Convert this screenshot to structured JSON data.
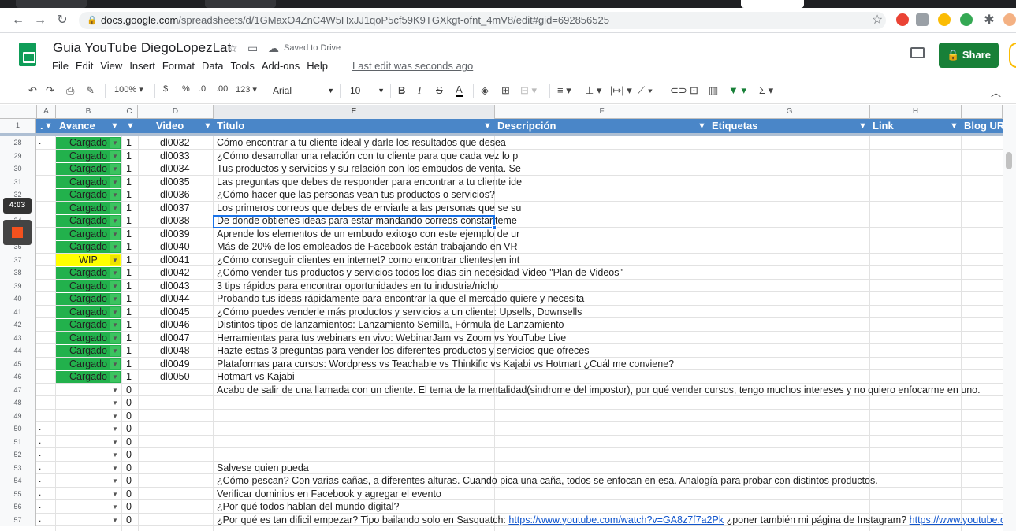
{
  "browser": {
    "url_host": "docs.google.com",
    "url_path": "/spreadsheets/d/1GMaxO4ZnC4W5HxJJ1qoP5cf59K9TGXkgt-ofnt_4mV8/edit#gid=692856525"
  },
  "doc": {
    "title": "Guia YouTube DiegoLopezLat",
    "saved_status": "Saved to Drive",
    "last_edit": "Last edit was seconds ago",
    "share_label": "Share",
    "menu": [
      "File",
      "Edit",
      "View",
      "Insert",
      "Format",
      "Data",
      "Tools",
      "Add-ons",
      "Help"
    ]
  },
  "toolbar": {
    "zoom": "100%",
    "currency": "$",
    "percent": "%",
    "dec_less": ".0",
    "dec_more": ".00",
    "format": "123",
    "font": "Arial",
    "font_size": "10",
    "bold": "B",
    "italic": "I",
    "strike": "S",
    "textcolor": "A",
    "sigma": "Σ"
  },
  "columns": [
    "A",
    "B",
    "C",
    "D",
    "E",
    "F",
    "G",
    "H"
  ],
  "header_row": {
    "num": "1",
    "a": ".",
    "b": "Avance",
    "d": "Video",
    "e": "Titulo",
    "f": "Descripción",
    "g": "Etiquetas",
    "h": "Link",
    "i": "Blog UR"
  },
  "rows": [
    {
      "num": "28",
      "a": ".",
      "status": "Cargado",
      "c": "1",
      "d": "dl0032",
      "e": "Cómo encontrar a tu cliente ideal y darle los resultados que desea"
    },
    {
      "num": "29",
      "a": "",
      "status": "Cargado",
      "c": "1",
      "d": "dl0033",
      "e": "¿Cómo desarrollar una relación con tu cliente para que cada vez lo p"
    },
    {
      "num": "30",
      "a": "",
      "status": "Cargado",
      "c": "1",
      "d": "dl0034",
      "e": "Tus productos y servicios y su relación con los embudos de venta. Se"
    },
    {
      "num": "31",
      "a": "",
      "status": "Cargado",
      "c": "1",
      "d": "dl0035",
      "e": "Las preguntas que debes de responder para encontrar a tu cliente ide"
    },
    {
      "num": "32",
      "a": "",
      "status": "Cargado",
      "c": "1",
      "d": "dl0036",
      "e": "¿Cómo hacer que las personas vean tus productos o servicios?"
    },
    {
      "num": "33",
      "a": "",
      "status": "Cargado",
      "c": "1",
      "d": "dl0037",
      "e": "Los primeros correos que debes de enviarle a las personas que se su"
    },
    {
      "num": "34",
      "a": "",
      "status": "Cargado",
      "c": "1",
      "d": "dl0038",
      "e": "De dónde obtienes ideas para estar mandando correos constanteme"
    },
    {
      "num": "35",
      "a": "",
      "status": "Cargado",
      "c": "1",
      "d": "dl0039",
      "e": "Aprende los elementos de un embudo exitoso con este ejemplo de ur"
    },
    {
      "num": "36",
      "a": "",
      "status": "Cargado",
      "c": "1",
      "d": "dl0040",
      "e": "Más de 20% de los empleados de Facebook están trabajando en VR"
    },
    {
      "num": "37",
      "a": "",
      "status": "WIP",
      "c": "1",
      "d": "dl0041",
      "e": "¿Cómo conseguir clientes en internet? como encontrar clientes en int"
    },
    {
      "num": "38",
      "a": "",
      "status": "Cargado",
      "c": "1",
      "d": "dl0042",
      "e": "¿Cómo vender tus productos y servicios todos los días sin necesidad Video \"Plan de Videos\""
    },
    {
      "num": "39",
      "a": "",
      "status": "Cargado",
      "c": "1",
      "d": "dl0043",
      "e": "3 tips rápidos para encontrar oportunidades en tu industria/nicho"
    },
    {
      "num": "40",
      "a": "",
      "status": "Cargado",
      "c": "1",
      "d": "dl0044",
      "e": "Probando tus ideas rápidamente para encontrar la que el mercado quiere y necesita"
    },
    {
      "num": "41",
      "a": "",
      "status": "Cargado",
      "c": "1",
      "d": "dl0045",
      "e": "¿Cómo puedes venderle más productos y servicios a un cliente: Upsells, Downsells"
    },
    {
      "num": "42",
      "a": "",
      "status": "Cargado",
      "c": "1",
      "d": "dl0046",
      "e": "Distintos tipos de lanzamientos: Lanzamiento Semilla, Fórmula de Lanzamiento"
    },
    {
      "num": "43",
      "a": "",
      "status": "Cargado",
      "c": "1",
      "d": "dl0047",
      "e": "Herramientas para tus webinars en vivo: WebinarJam vs Zoom vs YouTube Live"
    },
    {
      "num": "44",
      "a": "",
      "status": "Cargado",
      "c": "1",
      "d": "dl0048",
      "e": "Hazte estas 3 preguntas para vender los diferentes productos y servicios que ofreces"
    },
    {
      "num": "45",
      "a": "",
      "status": "Cargado",
      "c": "1",
      "d": "dl0049",
      "e": "Plataformas para cursos: Wordpress vs Teachable vs Thinkific vs Kajabi vs Hotmart ¿Cuál me conviene?"
    },
    {
      "num": "46",
      "a": "",
      "status": "Cargado",
      "c": "1",
      "d": "dl0050",
      "e": "Hotmart vs Kajabi"
    },
    {
      "num": "47",
      "a": "",
      "status": "",
      "c": "0",
      "d": "",
      "e": "Acabo de salir de una llamada con un cliente. El tema de la mentalidad(sindrome del impostor), por qué vender cursos, tengo muchos intereses y no quiero enfocarme en uno."
    },
    {
      "num": "48",
      "a": "",
      "status": "",
      "c": "0",
      "d": "",
      "e": ""
    },
    {
      "num": "49",
      "a": "",
      "status": "",
      "c": "0",
      "d": "",
      "e": ""
    },
    {
      "num": "50",
      "a": ".",
      "status": "",
      "c": "0",
      "d": "",
      "e": ""
    },
    {
      "num": "51",
      "a": ".",
      "status": "",
      "c": "0",
      "d": "",
      "e": ""
    },
    {
      "num": "52",
      "a": ".",
      "status": "",
      "c": "0",
      "d": "",
      "e": ""
    },
    {
      "num": "53",
      "a": ".",
      "status": "",
      "c": "0",
      "d": "",
      "e": "Salvese quien pueda"
    },
    {
      "num": "54",
      "a": ".",
      "status": "",
      "c": "0",
      "d": "",
      "e": "¿Cómo pescan? Con varias cañas, a diferentes alturas. Cuando pica una caña, todos se enfocan en esa. Analogía para probar con distintos productos."
    },
    {
      "num": "55",
      "a": ".",
      "status": "",
      "c": "0",
      "d": "",
      "e": "Verificar dominios en Facebook y agregar el evento"
    },
    {
      "num": "56",
      "a": ".",
      "status": "",
      "c": "0",
      "d": "",
      "e": "¿Por qué todos hablan del mundo digital?"
    },
    {
      "num": "57",
      "a": ".",
      "status": "",
      "c": "0",
      "d": "",
      "e": "¿Por qué es tan dificil empezar? Tipo bailando solo en Sasquatch: ",
      "link1": "https://www.youtube.com/watch?v=GA8z7f7a2Pk",
      "e2": " ¿poner también mi página de Instagram? ",
      "link2": "https://www.youtube.com/watch?v=h"
    }
  ],
  "recorder": {
    "time": "4:03"
  },
  "colors": {
    "cargado": "#22b14c",
    "wip": "#ffff00",
    "header": "#4a86c8",
    "share": "#188038"
  }
}
